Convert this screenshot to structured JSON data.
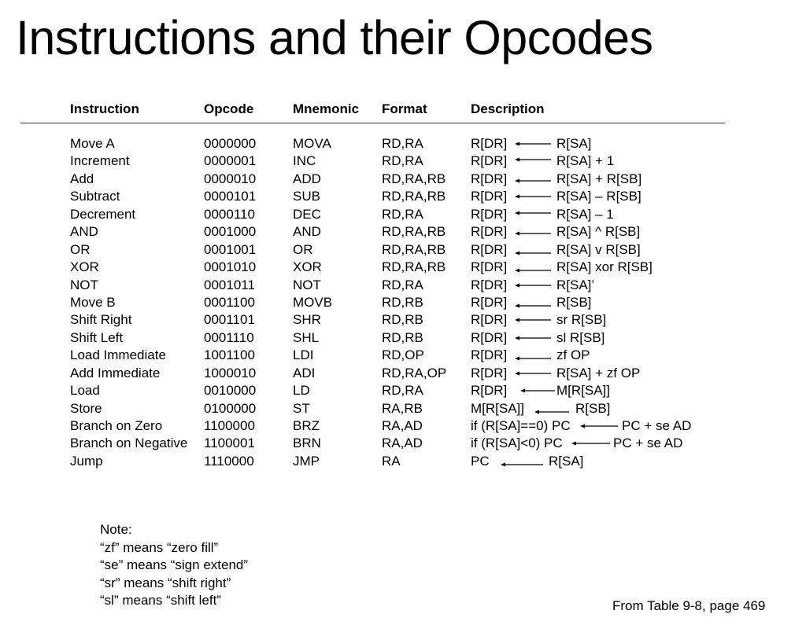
{
  "title": "Instructions and their Opcodes",
  "table": {
    "headers": {
      "instruction": "Instruction",
      "opcode": "Opcode",
      "mnemonic": "Mnemonic",
      "format": "Format",
      "description": "Description"
    },
    "rows": [
      {
        "instruction": "Move A",
        "opcode": "0000000",
        "mnemonic": "MOVA",
        "format": "RD,RA",
        "dest": "R[DR]",
        "src": "R[SA]"
      },
      {
        "instruction": "Increment",
        "opcode": "0000001",
        "mnemonic": "INC",
        "format": "RD,RA",
        "dest": "R[DR]",
        "src": "R[SA] + 1"
      },
      {
        "instruction": "Add",
        "opcode": "0000010",
        "mnemonic": "ADD",
        "format": "RD,RA,RB",
        "dest": "R[DR]",
        "src": "R[SA] + R[SB]"
      },
      {
        "instruction": "Subtract",
        "opcode": "0000101",
        "mnemonic": "SUB",
        "format": "RD,RA,RB",
        "dest": "R[DR]",
        "src": "R[SA] – R[SB]"
      },
      {
        "instruction": "Decrement",
        "opcode": "0000110",
        "mnemonic": "DEC",
        "format": "RD,RA",
        "dest": "R[DR]",
        "src": "R[SA] – 1"
      },
      {
        "instruction": "AND",
        "opcode": "0001000",
        "mnemonic": "AND",
        "format": "RD,RA,RB",
        "dest": "R[DR]",
        "src": "R[SA] ^ R[SB]"
      },
      {
        "instruction": "OR",
        "opcode": "0001001",
        "mnemonic": "OR",
        "format": "RD,RA,RB",
        "dest": "R[DR]",
        "src": "R[SA] v R[SB]"
      },
      {
        "instruction": "XOR",
        "opcode": "0001010",
        "mnemonic": "XOR",
        "format": "RD,RA,RB",
        "dest": "R[DR]",
        "src": "R[SA] xor R[SB]"
      },
      {
        "instruction": "NOT",
        "opcode": "0001011",
        "mnemonic": "NOT",
        "format": "RD,RA",
        "dest": "R[DR]",
        "src": "R[SA]’"
      },
      {
        "instruction": "Move B",
        "opcode": "0001100",
        "mnemonic": "MOVB",
        "format": "RD,RB",
        "dest": "R[DR]",
        "src": "R[SB]"
      },
      {
        "instruction": "Shift Right",
        "opcode": "0001101",
        "mnemonic": "SHR",
        "format": "RD,RB",
        "dest": "R[DR]",
        "src": "sr R[SB]"
      },
      {
        "instruction": "Shift Left",
        "opcode": "0001110",
        "mnemonic": "SHL",
        "format": "RD,RB",
        "dest": "R[DR]",
        "src": "sl R[SB]"
      },
      {
        "instruction": "Load Immediate",
        "opcode": "1001100",
        "mnemonic": "LDI",
        "format": "RD,OP",
        "dest": "R[DR]",
        "src": "zf OP"
      },
      {
        "instruction": "Add Immediate",
        "opcode": "1000010",
        "mnemonic": "ADI",
        "format": "RD,RA,OP",
        "dest": "R[DR]",
        "src": "R[SA] + zf OP"
      },
      {
        "instruction": "Load",
        "opcode": "0010000",
        "mnemonic": "LD",
        "format": "RD,RA",
        "dest": "R[DR]",
        "src": "M[R[SA]]"
      },
      {
        "instruction": "Store",
        "opcode": "0100000",
        "mnemonic": "ST",
        "format": "RA,RB",
        "dest": "M[R[SA]]",
        "src": "R[SB]"
      },
      {
        "instruction": "Branch on Zero",
        "opcode": "1100000",
        "mnemonic": "BRZ",
        "format": "RA,AD",
        "dest": "if (R[SA]==0) PC",
        "src": "PC + se AD"
      },
      {
        "instruction": "Branch on Negative",
        "opcode": "1100001",
        "mnemonic": "BRN",
        "format": "RA,AD",
        "dest": "if (R[SA]<0) PC",
        "src": "PC + se AD"
      },
      {
        "instruction": "Jump",
        "opcode": "1110000",
        "mnemonic": "JMP",
        "format": "RA",
        "dest": "PC",
        "src": "R[SA]"
      }
    ]
  },
  "notes": {
    "heading": "Note:",
    "lines": [
      "“zf” means “zero fill”",
      "“se” means “sign extend”",
      "“sr” means “shift right”",
      "“sl” means “shift left”"
    ]
  },
  "source": "From Table 9-8, page 469"
}
